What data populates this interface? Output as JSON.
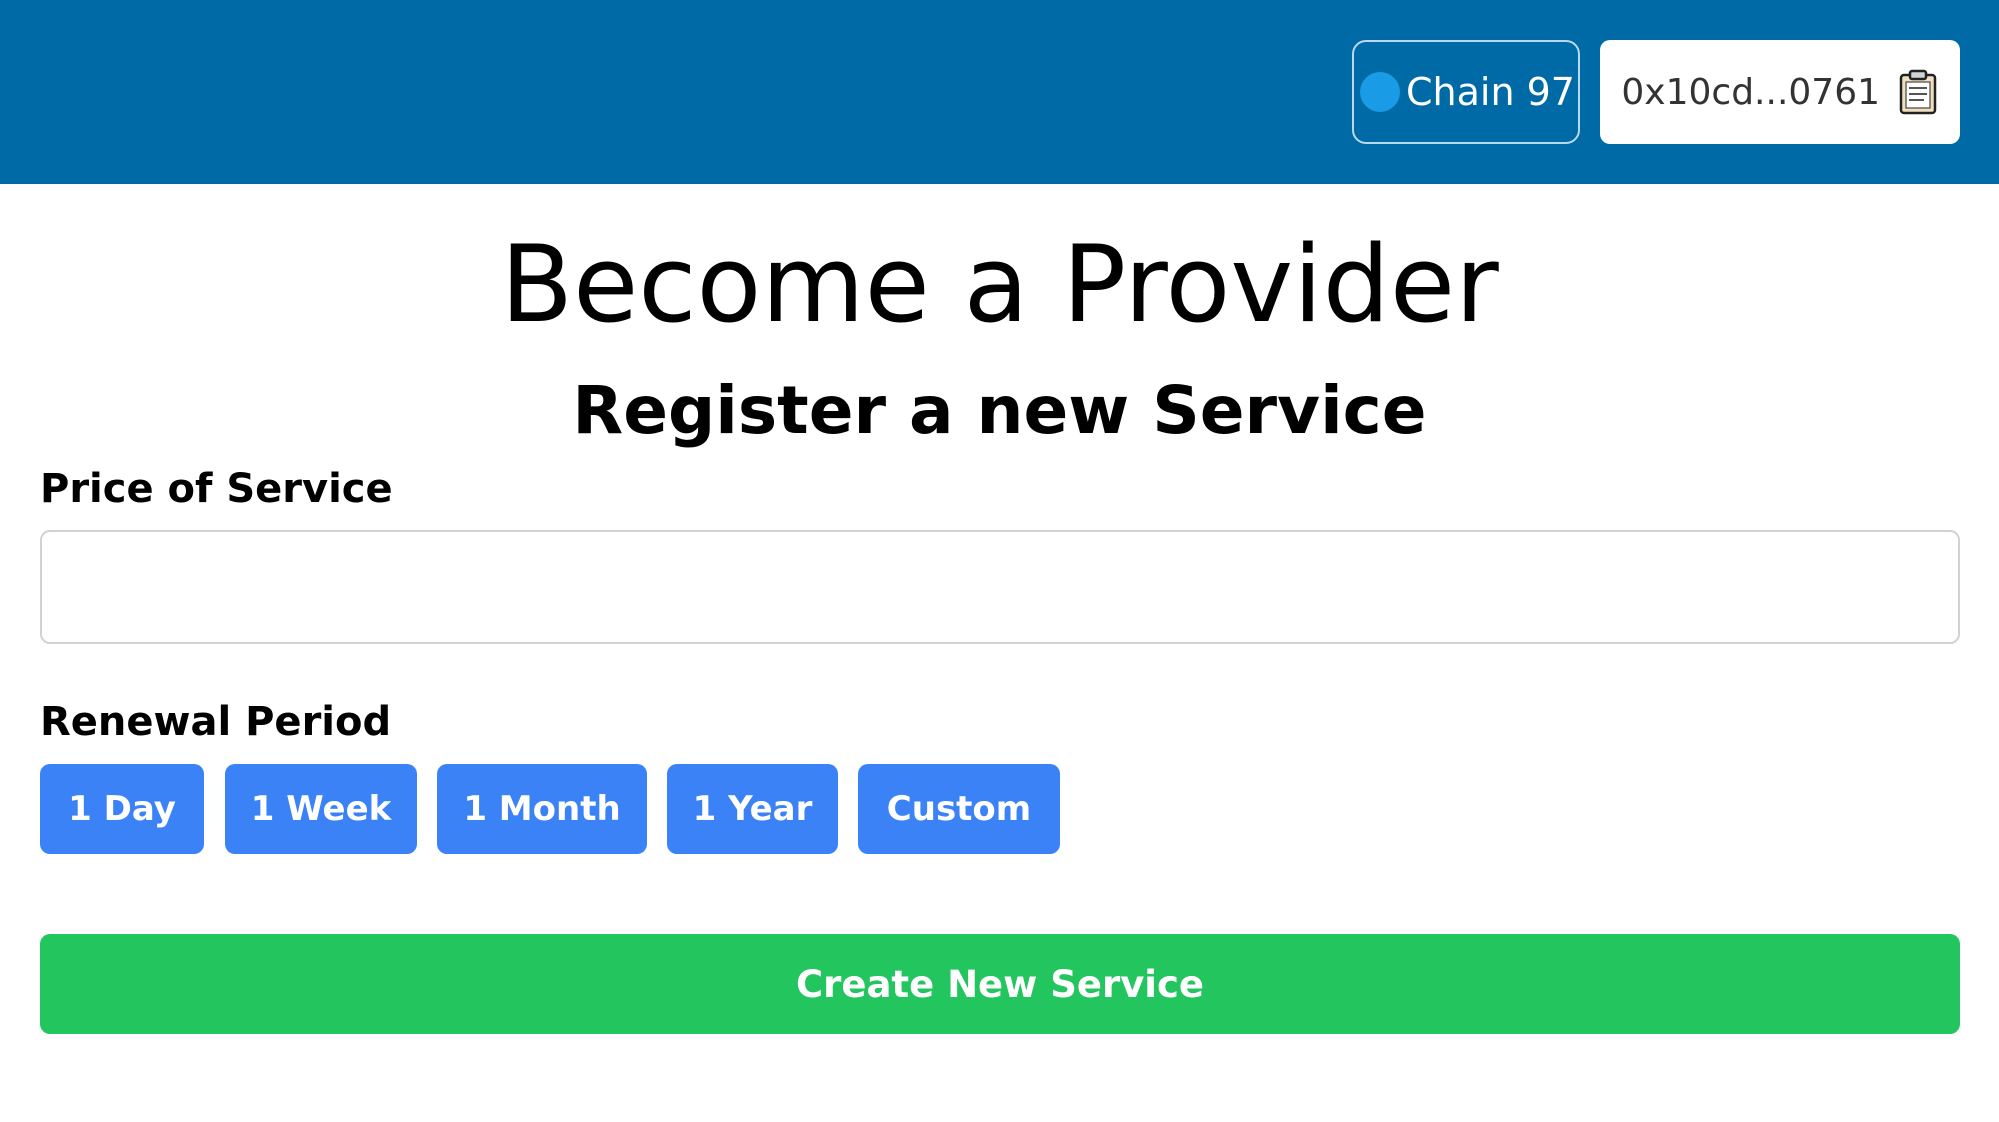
{
  "header": {
    "chain_label": "Chain 97",
    "account_label": "0x10cd...0761",
    "chain_icon": "network-dot-icon",
    "copy_icon": "clipboard-icon"
  },
  "main": {
    "title": "Become a Provider",
    "subtitle": "Register a new Service",
    "price_label": "Price of Service",
    "price_value": "",
    "renewal_label": "Renewal Period",
    "renewal_options": [
      "1 Day",
      "1 Week",
      "1 Month",
      "1 Year",
      "Custom"
    ],
    "submit_label": "Create New Service"
  },
  "colors": {
    "header_bg": "#006aa6",
    "period_button": "#3b82f6",
    "submit_button": "#22c55e",
    "chain_dot": "#1a9be6"
  }
}
